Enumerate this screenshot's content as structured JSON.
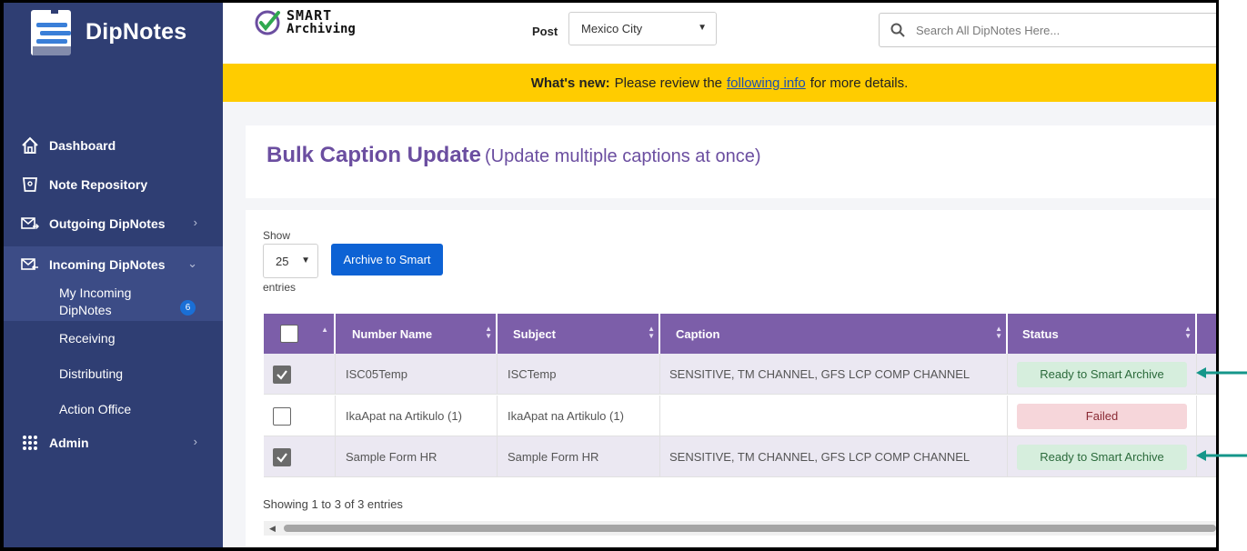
{
  "app": {
    "name": "DipNotes",
    "brand_colors": {
      "sidebar": "#2f3e73",
      "accent_purple": "#7c5ea9",
      "primary_button": "#0d62d4",
      "banner": "#ffcc00"
    }
  },
  "sidebar": {
    "items": [
      {
        "label": "Dashboard",
        "icon": "home-icon"
      },
      {
        "label": "Note Repository",
        "icon": "bin-icon"
      },
      {
        "label": "Outgoing DipNotes",
        "icon": "mail-out-icon"
      },
      {
        "label": "Incoming DipNotes",
        "icon": "mail-in-icon"
      },
      {
        "label": "Admin",
        "icon": "grid-dots-icon"
      }
    ],
    "incoming_sub": [
      {
        "label": "My Incoming DipNotes",
        "line1": "My Incoming",
        "line2": "DipNotes",
        "badge": "6"
      },
      {
        "label": "Receiving"
      },
      {
        "label": "Distributing"
      },
      {
        "label": "Action Office"
      }
    ]
  },
  "header": {
    "smart_logo_line1": "SMART",
    "smart_logo_line2": "Archiving",
    "post_label": "Post",
    "post_value": "Mexico City",
    "search_placeholder": "Search All DipNotes Here..."
  },
  "banner": {
    "bold": "What's new:",
    "pre_link": "Please review the",
    "link": "following info",
    "post_link": "for more details."
  },
  "page": {
    "title": "Bulk Caption Update",
    "subtitle": "(Update multiple captions at once)"
  },
  "table_controls": {
    "show_label": "Show",
    "page_length": "25",
    "entries_label": "entries",
    "archive_button": "Archive to Smart"
  },
  "table": {
    "columns": [
      "Number Name",
      "Subject",
      "Caption",
      "Status"
    ],
    "rows": [
      {
        "checked": true,
        "number_name": "ISC05Temp",
        "subject": "ISCTemp",
        "caption": "SENSITIVE, TM CHANNEL, GFS LCP COMP CHANNEL",
        "status": "Ready to Smart Archive",
        "status_kind": "ready"
      },
      {
        "checked": false,
        "number_name": "IkaApat na Artikulo (1)",
        "subject": "IkaApat na Artikulo (1)",
        "caption": "",
        "status": "Failed",
        "status_kind": "failed"
      },
      {
        "checked": true,
        "number_name": "Sample Form HR",
        "subject": "Sample Form HR",
        "caption": "SENSITIVE, TM CHANNEL, GFS LCP COMP CHANNEL",
        "status": "Ready to Smart Archive",
        "status_kind": "ready"
      }
    ],
    "info": "Showing 1 to 3 of 3 entries"
  }
}
